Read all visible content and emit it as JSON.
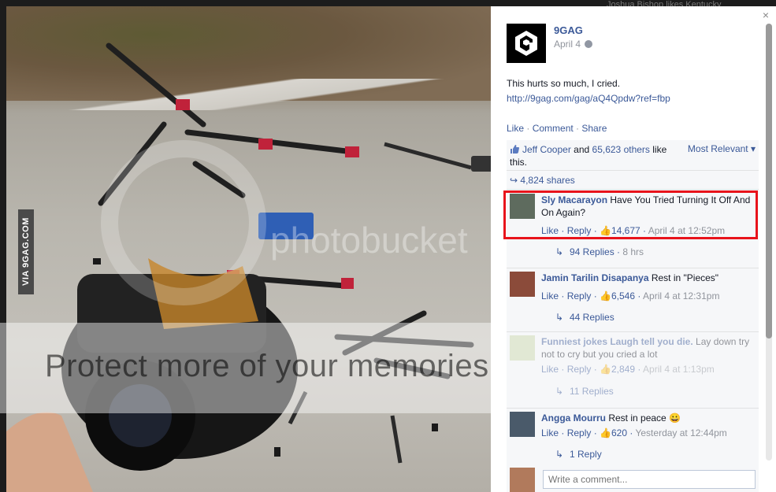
{
  "header": {
    "top_strip_text": "Joshua Bishop likes Kentucky"
  },
  "photo": {
    "via_badge": "VIA 9GAG.COM",
    "watermark_text": "Protect more of your memories for less!",
    "watermark_logo": "photobucket"
  },
  "post": {
    "page_name": "9GAG",
    "date": "April 4",
    "text": "This hurts so much, I cried.",
    "link": "http://9gag.com/gag/aQ4Qpdw?ref=fbp",
    "actions": {
      "like": "Like",
      "comment": "Comment",
      "share": "Share",
      "sep": " · "
    }
  },
  "ufi": {
    "like_sentence": {
      "name": "Jeff Cooper",
      "and": " and ",
      "others": "65,623 others",
      "tail": " like this."
    },
    "sort_label": "Most Relevant",
    "shares": "4,824 shares",
    "comments": [
      {
        "author": "Sly Macarayon",
        "text": "Have You Tried Turning It Off And On Again?",
        "like": "Like",
        "reply": "Reply",
        "likes": "14,677",
        "time": "April 4 at 12:52pm",
        "replies": "94 Replies",
        "replies_time": "8 hrs"
      },
      {
        "author": "Jamin Tarilin Disapanya",
        "text": "Rest in \"Pieces\"",
        "like": "Like",
        "reply": "Reply",
        "likes": "6,546",
        "time": "April 4 at 12:31pm",
        "replies": "44 Replies"
      },
      {
        "author": "Funniest jokes Laugh tell you die.",
        "text": "Lay down try not to cry but you cried a lot",
        "like": "Like",
        "reply": "Reply",
        "likes": "2,849",
        "time": "April 4 at 1:13pm",
        "replies": "11 Replies"
      },
      {
        "author": "Angga Mourru",
        "text": "Rest in peace",
        "like": "Like",
        "reply": "Reply",
        "likes": "620",
        "time": "Yesterday at 12:44pm",
        "replies": "1 Reply"
      }
    ],
    "write_placeholder": "Write a comment..."
  },
  "close_symbol": "×",
  "colors": {
    "accent": "#3b5998",
    "highlight": "#e8131b",
    "panel": "#f6f7f9"
  }
}
